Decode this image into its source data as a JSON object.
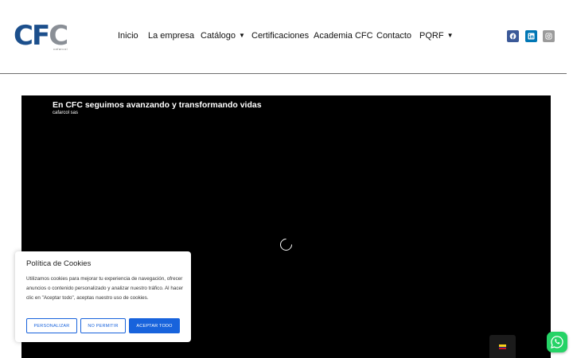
{
  "header": {
    "logo_text_blue": "CF",
    "logo_text_grey": "C",
    "logo_sub": "cafarcol"
  },
  "nav": {
    "items": [
      {
        "label": "Inicio",
        "dropdown": false
      },
      {
        "label": "La empresa",
        "dropdown": false
      },
      {
        "label": "Catálogo",
        "dropdown": true
      },
      {
        "label": "Certificaciones",
        "dropdown": false
      },
      {
        "label": "Academia CFC",
        "dropdown": false
      },
      {
        "label": "Contacto",
        "dropdown": false
      },
      {
        "label": "PQRF",
        "dropdown": true
      }
    ]
  },
  "social": [
    {
      "icon": "facebook-icon",
      "color": "#3b5998"
    },
    {
      "icon": "linkedin-icon",
      "color": "#0077b5"
    },
    {
      "icon": "instagram-icon",
      "color": "#9b9b9b"
    }
  ],
  "video": {
    "title": "En CFC seguimos avanzando y transformando vidas",
    "channel": "cafarcol sas"
  },
  "cookie": {
    "title": "Política de Cookies",
    "text": "Utilizamos cookies para mejorar tu experiencia de navegación, ofrecer anuncios o contenido personalizado y analizar nuestro tráfico. Al hacer clic en \"Aceptar todo\", aceptas nuestro uso de cookies.",
    "customize_label": "PERSONALIZAR",
    "reject_label": "NO PERMITIR",
    "accept_label": "ACEPTAR TODO",
    "accent_color": "#1863dc"
  },
  "language_switcher": {
    "icon": "colombia-flag-icon"
  },
  "whatsapp": {
    "icon": "whatsapp-icon",
    "color": "#25d366"
  }
}
